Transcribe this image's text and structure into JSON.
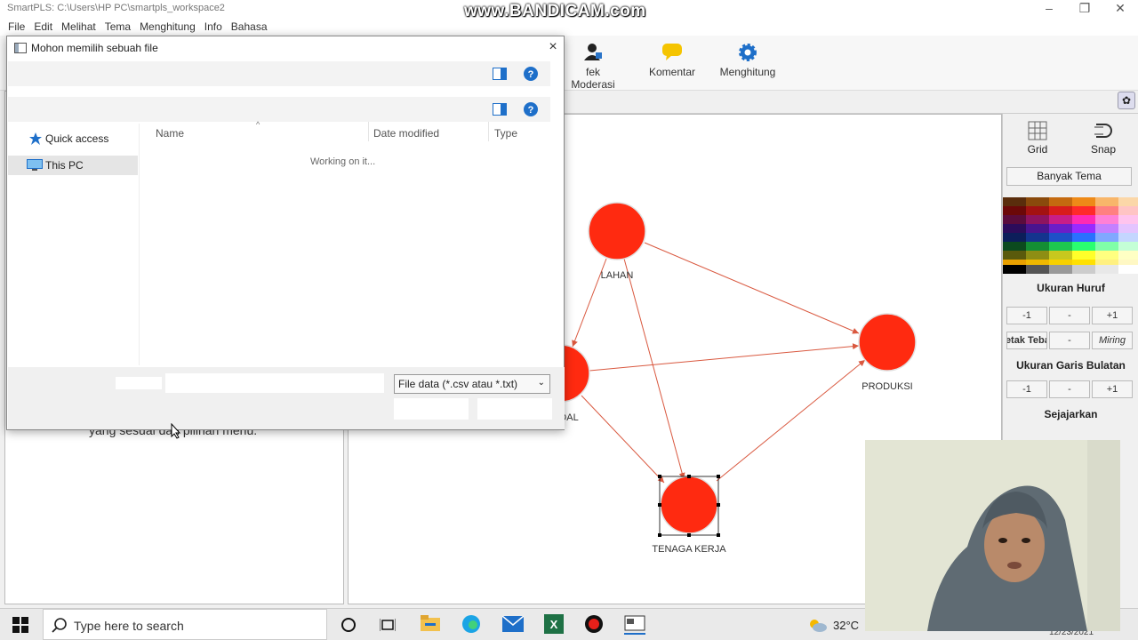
{
  "app": {
    "title": "SmartPLS: C:\\Users\\HP PC\\smartpls_workspace2"
  },
  "watermark": "www.BANDICAM.com",
  "menu": [
    "File",
    "Edit",
    "Melihat",
    "Tema",
    "Menghitung",
    "Info",
    "Bahasa"
  ],
  "toolbar": [
    {
      "label": "fek Moderasi",
      "icon": "user-add-icon"
    },
    {
      "label": "Komentar",
      "icon": "comment-icon"
    },
    {
      "label": "Menghitung",
      "icon": "gear-icon"
    }
  ],
  "left_hint": "yang sesuai dari pilihan menu.",
  "canvas": {
    "nodes": [
      {
        "id": "lahan",
        "label": "LAHAN"
      },
      {
        "id": "produksi",
        "label": "PRODUKSI"
      },
      {
        "id": "modal",
        "label": "DAL"
      },
      {
        "id": "tenaga",
        "label": "TENAGA KERJA"
      }
    ]
  },
  "right_panel": {
    "grid_label": "Grid",
    "snap_label": "Snap",
    "themes_button": "Banyak Tema",
    "font_size_heading": "Ukuran Huruf",
    "font_size_buttons": [
      "-1",
      "-",
      "+1"
    ],
    "style_buttons": [
      "Cetak Tebal",
      "-",
      "Miring"
    ],
    "circle_line_heading": "Ukuran Garis Bulatan",
    "circle_line_buttons": [
      "-1",
      "-",
      "+1"
    ],
    "align_heading": "Sejajarkan"
  },
  "dialog": {
    "title": "Mohon memilih sebuah file",
    "close": "×",
    "columns": {
      "name": "Name",
      "date": "Date modified",
      "type": "Type"
    },
    "nav": [
      "Quick access",
      "This PC"
    ],
    "status": "Working on it...",
    "file_type": "File data (*.csv atau *.txt)"
  },
  "taskbar": {
    "search_placeholder": "Type here to search",
    "temperature": "32°C",
    "date": "12/23/2021"
  },
  "colors": {
    "node": "#ff2a10",
    "edge": "#d9583f",
    "accent": "#0a64b4"
  }
}
